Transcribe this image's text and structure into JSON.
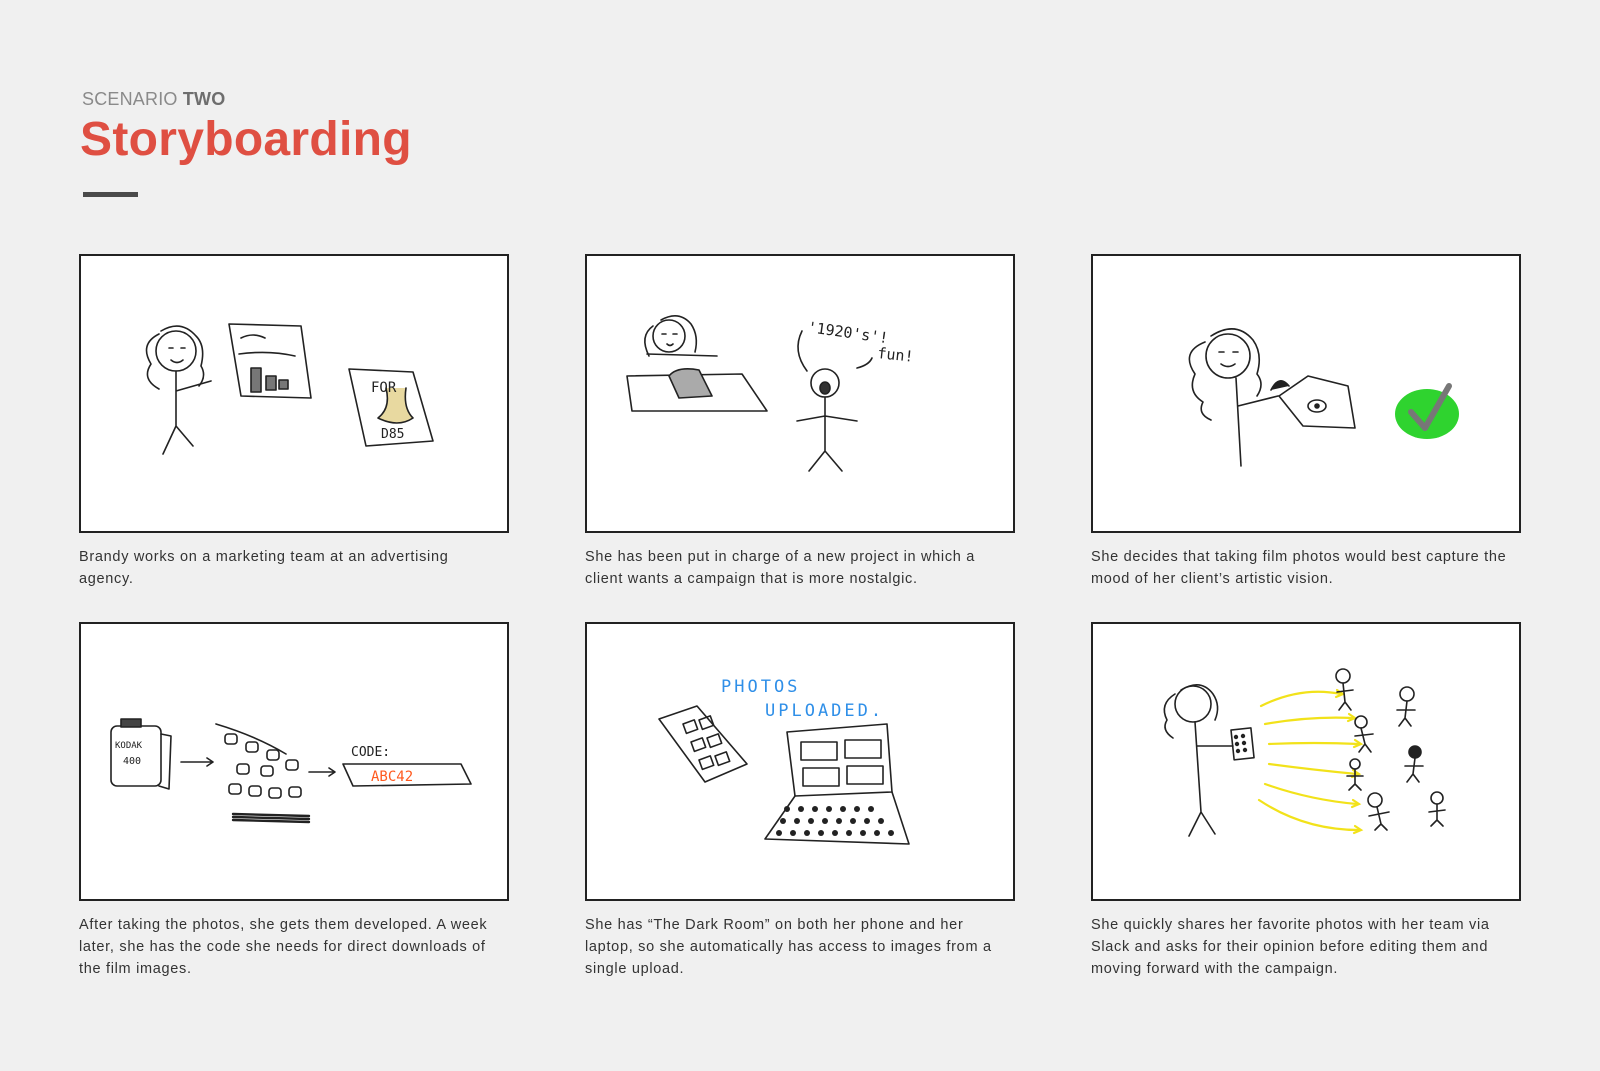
{
  "header": {
    "eyebrow_light": "SCENARIO",
    "eyebrow_bold": "TWO",
    "title": "Storyboarding"
  },
  "panels": [
    {
      "caption": "Brandy works on a marketing team at an advertising agency.",
      "sketch_text": [
        "FOR",
        "D85"
      ]
    },
    {
      "caption": "She has been put in charge of a new project in which a client wants a campaign that is more nostalgic.",
      "sketch_text": [
        "'1920's'!",
        "fun!"
      ]
    },
    {
      "caption": "She decides that taking film photos would best capture the mood of her client’s artistic vision.",
      "sketch_text": []
    },
    {
      "caption": "After taking the photos, she gets them developed. A week later, she has the code she needs for direct downloads of the film images.",
      "sketch_text": [
        "KODAK",
        "400",
        "CODE:",
        "ABC42"
      ]
    },
    {
      "caption": "She has “The Dark Room” on both her phone and her laptop, so she automatically has access to images from a single upload.",
      "sketch_text": [
        "PHOTOS",
        "UPLOADED."
      ]
    },
    {
      "caption": "She quickly shares her favorite photos with her team via Slack and asks for their opinion before editing them and moving forward with the campaign.",
      "sketch_text": []
    }
  ],
  "colors": {
    "accent": "#df4f42",
    "background": "#f0f0f0",
    "sketch_green": "#2fd32f",
    "sketch_blue": "#2f8fe8",
    "sketch_orange": "#ff5a1f",
    "sketch_yellow": "#f2e21a"
  }
}
